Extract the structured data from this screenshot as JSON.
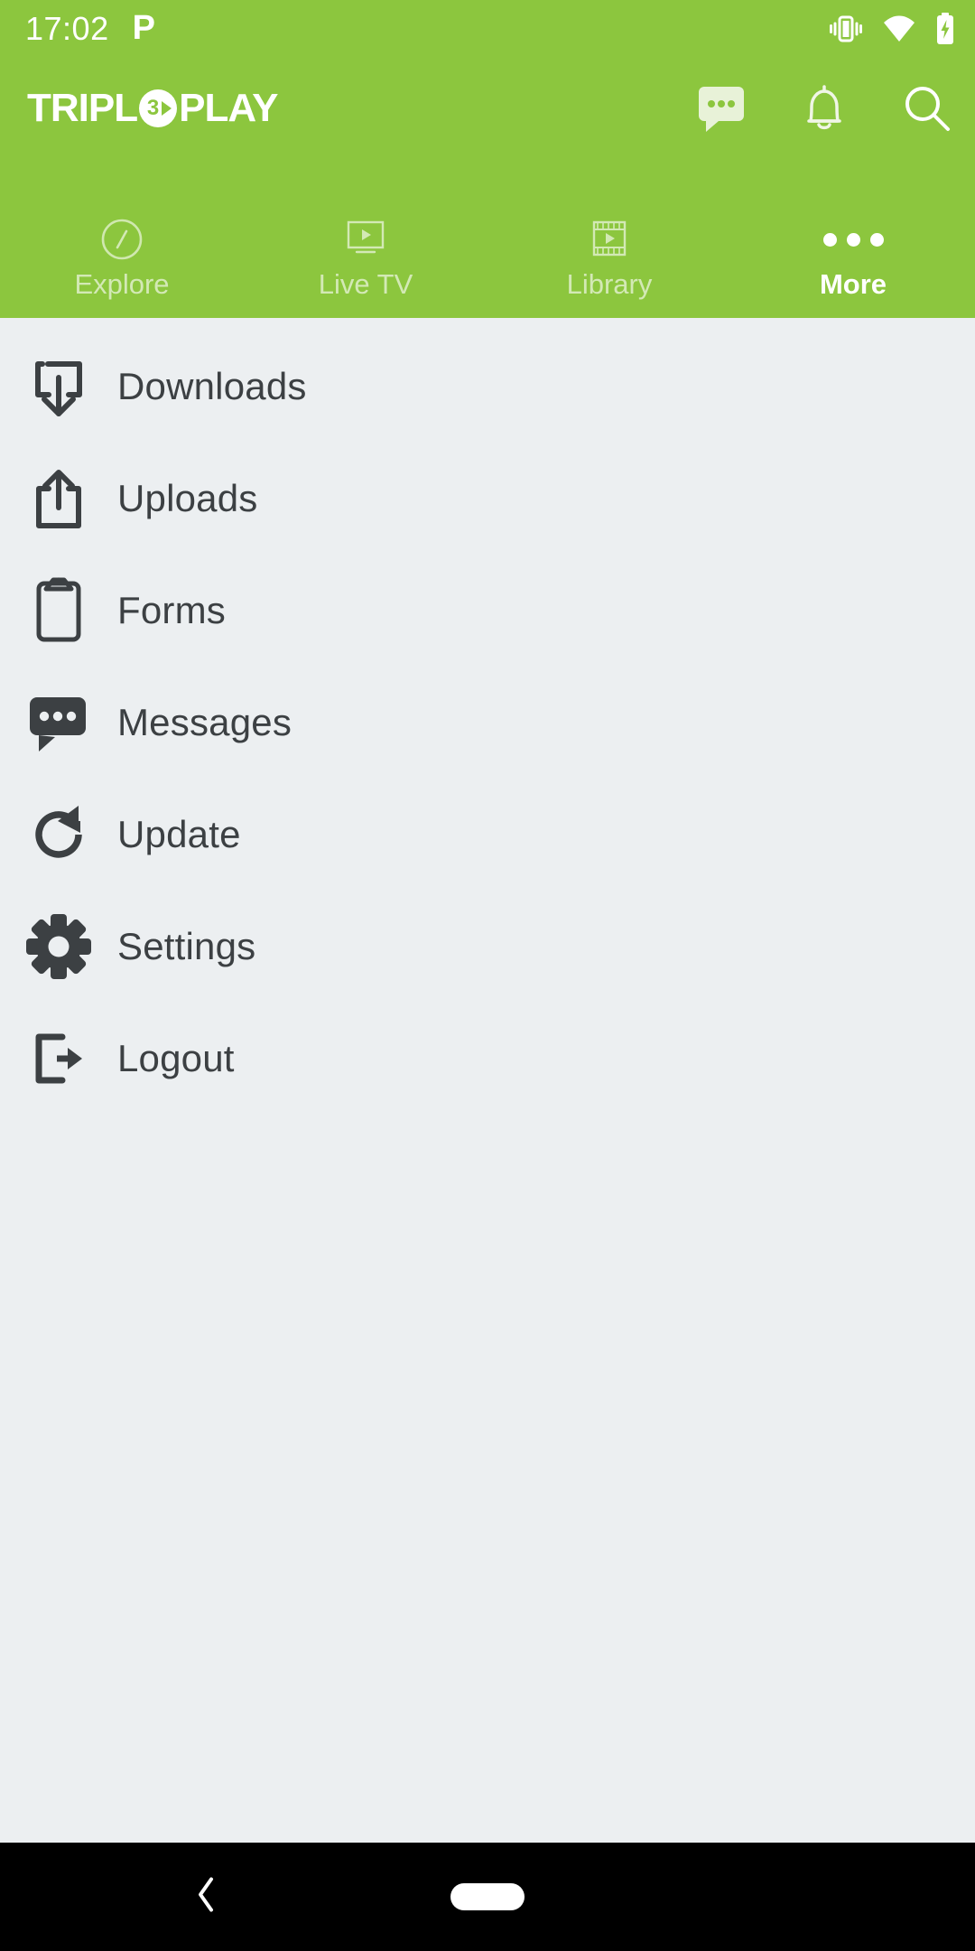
{
  "status_bar": {
    "time": "17:02",
    "app_indicator": "P",
    "icons": [
      "vibrate-icon",
      "wifi-icon",
      "battery-charging-icon"
    ]
  },
  "header": {
    "brand_color": "#8cc63e",
    "logo": {
      "part1": "TRIPL",
      "mark": "3",
      "part2": "PLAY",
      "full": "TRIPL3PLAY"
    },
    "actions": [
      {
        "name": "messages-icon",
        "label": "Messages"
      },
      {
        "name": "notifications-bell-icon",
        "label": "Notifications"
      },
      {
        "name": "search-icon",
        "label": "Search"
      }
    ],
    "tabs": [
      {
        "label": "Explore",
        "icon": "compass-icon",
        "active": false
      },
      {
        "label": "Live TV",
        "icon": "tv-icon",
        "active": false
      },
      {
        "label": "Library",
        "icon": "film-strip-icon",
        "active": false
      },
      {
        "label": "More",
        "icon": "more-dots-icon",
        "active": true
      }
    ]
  },
  "menu": {
    "items": [
      {
        "label": "Downloads",
        "icon": "download-icon"
      },
      {
        "label": "Uploads",
        "icon": "upload-icon"
      },
      {
        "label": "Forms",
        "icon": "clipboard-icon"
      },
      {
        "label": "Messages",
        "icon": "chat-bubble-icon"
      },
      {
        "label": "Update",
        "icon": "refresh-icon"
      },
      {
        "label": "Settings",
        "icon": "gear-icon"
      },
      {
        "label": "Logout",
        "icon": "logout-icon"
      }
    ]
  },
  "system_nav": {
    "back": "back-chevron",
    "home": "home-pill"
  },
  "colors": {
    "brand_green": "#8cc63e",
    "page_background": "#eceff1",
    "text_dark": "#3c4043",
    "nav_bar": "#000000",
    "on_brand": "#ffffff"
  }
}
